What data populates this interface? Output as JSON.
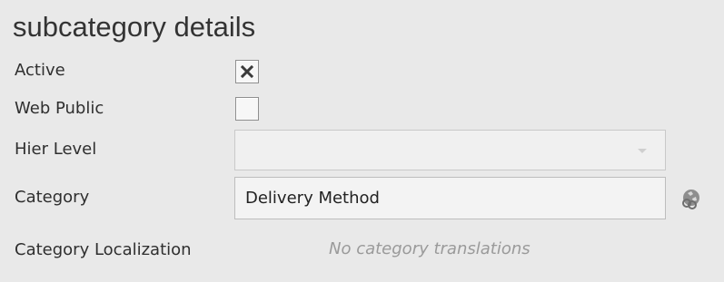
{
  "panel": {
    "title": "subcategory details"
  },
  "fields": {
    "active": {
      "label": "Active",
      "checked": true
    },
    "web_public": {
      "label": "Web Public",
      "checked": false
    },
    "hier_level": {
      "label": "Hier Level",
      "value": ""
    },
    "category": {
      "label": "Category",
      "value": "Delivery Method",
      "lookup_icon": "globe-link-icon"
    },
    "category_localization": {
      "label": "Category Localization",
      "value": "No category translations"
    }
  },
  "colors": {
    "background": "#e9e9e9",
    "muted_text": "#9a9a9a"
  }
}
